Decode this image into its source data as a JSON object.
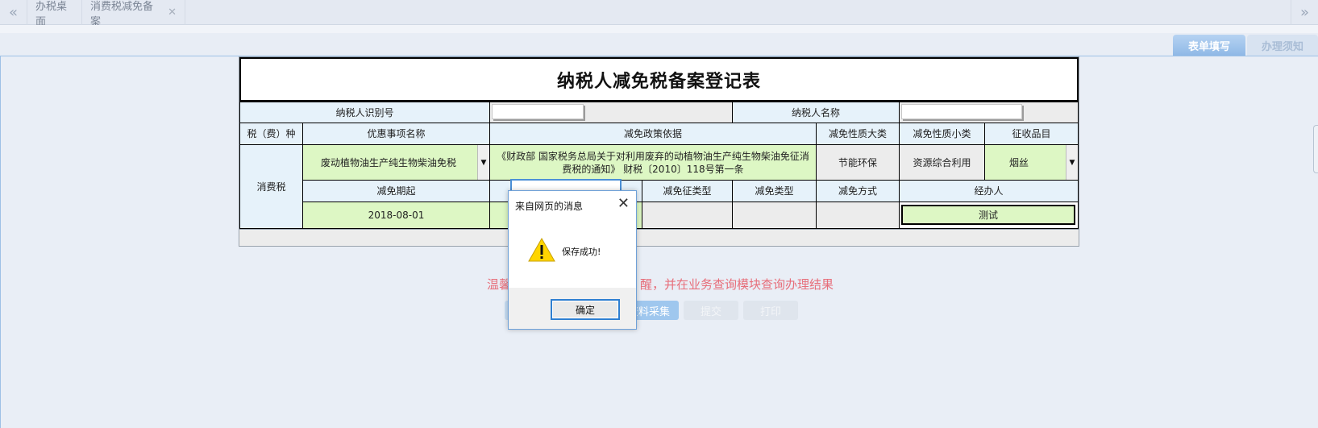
{
  "tabs": [
    {
      "label": "办税桌面",
      "closable": false
    },
    {
      "label": "消费税减免备案",
      "closable": true
    }
  ],
  "icons": {
    "nav_left": "«",
    "nav_right": "»",
    "close": "✕",
    "dropdown": "▼",
    "warning": "warning-icon"
  },
  "right_tabs": {
    "form_fill": "表单填写",
    "notice": "办理须知"
  },
  "form": {
    "title": "纳税人减免税备案登记表",
    "taxpayer_id_label": "纳税人识别号",
    "taxpayer_id_value": "",
    "taxpayer_name_label": "纳税人名称",
    "taxpayer_name_value": "",
    "headers": {
      "tax_type": "税（费）种",
      "preference_item": "优惠事项名称",
      "policy_basis": "减免政策依据",
      "nature_major": "减免性质大类",
      "nature_minor": "减免性质小类",
      "levy_item": "征收品目"
    },
    "row": {
      "tax_type": "消费税",
      "preference_item": "废动植物油生产纯生物柴油免税",
      "policy_basis": "《财政部 国家税务总局关于对利用废弃的动植物油生产纯生物柴油免征消费税的通知》 财税〔2010〕118号第一条",
      "nature_major": "节能环保",
      "nature_minor": "资源综合利用",
      "levy_item": "烟丝"
    },
    "headers2": {
      "start_date": "减免期起",
      "levy_type": "减免征类型",
      "reduction_type": "减免类型",
      "reduction_method": "减免方式",
      "handler": "经办人"
    },
    "row2": {
      "start_date": "2018-08-01",
      "handler": "测试"
    }
  },
  "tip": {
    "prefix": "温馨",
    "suffix": "醒，并在业务查询模块查询办理结果"
  },
  "buttons": {
    "collect": "资料采集",
    "submit": "提交",
    "print": "打印"
  },
  "dialog": {
    "title": "来自网页的消息",
    "message": "保存成功!",
    "ok": "确定"
  }
}
